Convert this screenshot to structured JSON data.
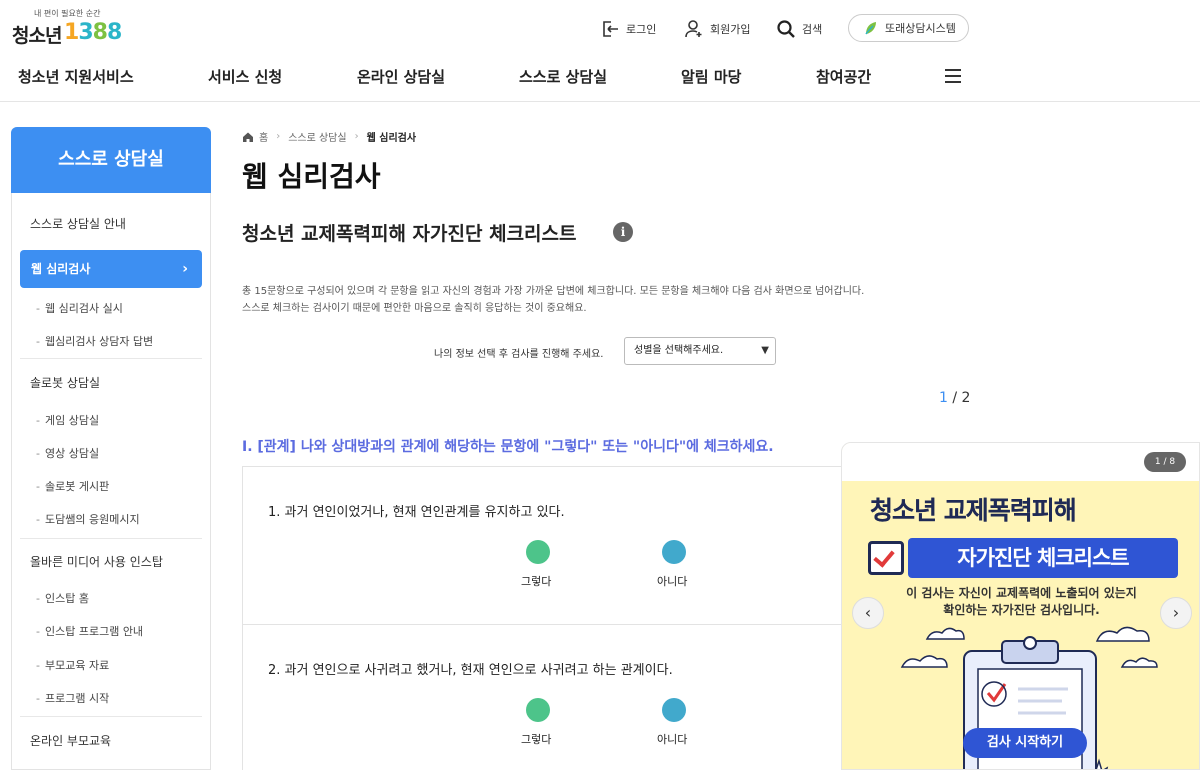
{
  "header": {
    "logo_tagline": "내 편이 필요한 순간",
    "logo_name": "청소년",
    "logo_number_1": "1",
    "logo_number_2": "3",
    "logo_number_3": "8",
    "logo_number_4": "8",
    "login_label": "로그인",
    "join_label": "회원가입",
    "search_label": "검색",
    "system_label": "또래상담시스템"
  },
  "gnb": [
    {
      "label": "청소년 지원서비스"
    },
    {
      "label": "서비스 신청"
    },
    {
      "label": "온라인 상담실"
    },
    {
      "label": "스스로 상담실"
    },
    {
      "label": "알림 마당"
    },
    {
      "label": "참여공간"
    }
  ],
  "sidebar": {
    "title": "스스로 상담실",
    "guide": "스스로 상담실 안내",
    "active": "웹 심리검사",
    "active_sub": [
      "웹 심리검사 실시",
      "웹심리검사 상담자 답변"
    ],
    "group2": "솔로봇 상담실",
    "group2_sub": [
      "게임 상담실",
      "영상 상담실",
      "솔로봇 게시판",
      "도담쌤의 응원메시지"
    ],
    "group3": "올바른 미디어 사용 인스탑",
    "group3_sub": [
      "인스탑 홈",
      "인스탑 프로그램 안내",
      "부모교육 자료",
      "프로그램 시작"
    ],
    "group4": "온라인 부모교육"
  },
  "breadcrumb": {
    "home": "홈",
    "level1": "스스로 상담실",
    "current": "웹 심리검사"
  },
  "main": {
    "title": "웹 심리검사",
    "subtitle": "청소년 교제폭력피해 자가진단 체크리스트",
    "info_icon": "i",
    "desc_line1": "총 15문항으로 구성되어 있으며 각 문항을 읽고 자신의 경험과 가장 가까운 답변에 체크합니다. 모든 문항을 체크해야 다음 검사 화면으로 넘어갑니다.",
    "desc_line2": "스스로 체크하는 검사이기 때문에 편안한 마음으로 솔직히 응답하는 것이 중요해요.",
    "gender_label": "나의 정보 선택 후 검사를 진행해 주세요.",
    "gender_placeholder": "성별을 선택해주세요.",
    "pager_current": "1",
    "pager_total": " / 2",
    "section_title": "I. [관계] 나와 상대방과의 관계에 해당하는 문항에 \"그렇다\" 또는 \"아니다\"에 체크하세요.",
    "questions": [
      {
        "text": "1. 과거 연인이었거나, 현재 연인관계를 유지하고 있다.",
        "yes": "그렇다",
        "no": "아니다"
      },
      {
        "text": "2. 과거 연인으로 사귀려고 했거나, 현재 연인으로 사귀려고 하는 관계이다.",
        "yes": "그렇다",
        "no": "아니다"
      }
    ]
  },
  "banner": {
    "counter": "1 / 8",
    "title": "청소년 교제폭력피해",
    "subtitle": "자가진단 체크리스트",
    "desc_line1": "이 검사는 자신이 교제폭력에 노출되어 있는지",
    "desc_line2": "확인하는 자가진단 검사입니다.",
    "cta": "검사 시작하기",
    "prev_icon": "‹",
    "next_icon": "›"
  },
  "colors": {
    "primary": "#3d8ff2",
    "section_title": "#5b6be0",
    "yes_dot": "#4dc48a",
    "no_dot": "#41a9cc",
    "banner_blue": "#2f55d4"
  }
}
